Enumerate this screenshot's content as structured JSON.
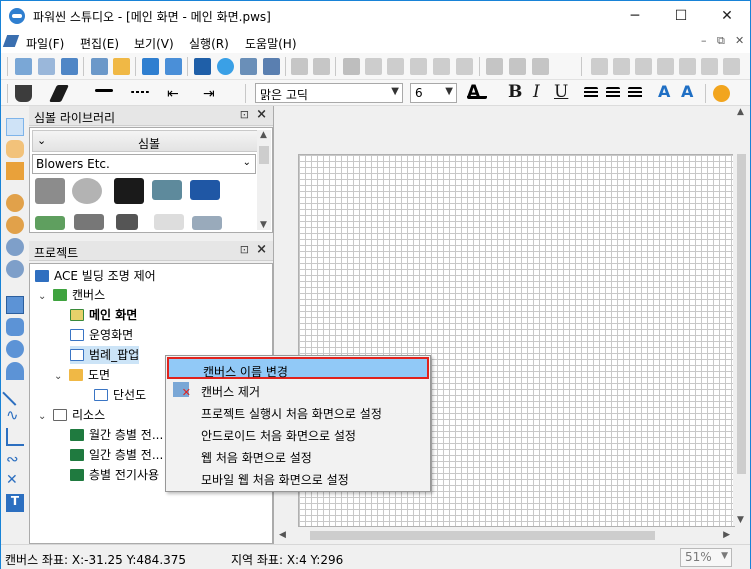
{
  "window": {
    "title": "파워씬 스튜디오 - [메인 화면 - 메인 화면.pws]",
    "minimize": "─",
    "maximize": "☐",
    "close": "✕"
  },
  "menu": {
    "items": [
      "파일(F)",
      "편집(E)",
      "보기(V)",
      "실행(R)",
      "도움말(H)"
    ],
    "mdi_minimize": "–",
    "mdi_restore": "⧉",
    "mdi_close": "✕"
  },
  "format_toolbar": {
    "font": "맑은 고딕",
    "size": "6",
    "bold": "B",
    "italic": "I",
    "underline": "U"
  },
  "symbol_library": {
    "title": "심볼 라이브러리",
    "category": "심볼",
    "selected_set": "Blowers Etc."
  },
  "project": {
    "title": "프로젝트",
    "root": "ACE 빌딩 조명 제어",
    "canvas_folder": "캔버스",
    "canvases": [
      "메인 화면",
      "운영화면",
      "범례_팝업"
    ],
    "drawing_folder": "도면",
    "drawings": [
      "단선도"
    ],
    "resource_folder": "리소스",
    "resources": [
      "월간 층별 전...",
      "일간 층별 전...",
      "층별 전기사용"
    ]
  },
  "context_menu": {
    "items": [
      "캔버스 이름 변경",
      "캔버스 제거",
      "프로젝트 실행시 처음 화면으로 설정",
      "안드로이드 처음 화면으로 설정",
      "웹 처음 화면으로 설정",
      "모바일 웹 처음 화면으로 설정"
    ],
    "highlight_color": "#91c9f7",
    "focus_border_color": "#e1221c"
  },
  "status_bar": {
    "canvas_coords": "캔버스 좌표: X:-31.25 Y:484.375",
    "region_coords": "지역 좌표: X:4 Y:296",
    "zoom": "51%"
  },
  "colors": {
    "accent": "#1883d7",
    "grid_line": "#c8c8c8"
  }
}
